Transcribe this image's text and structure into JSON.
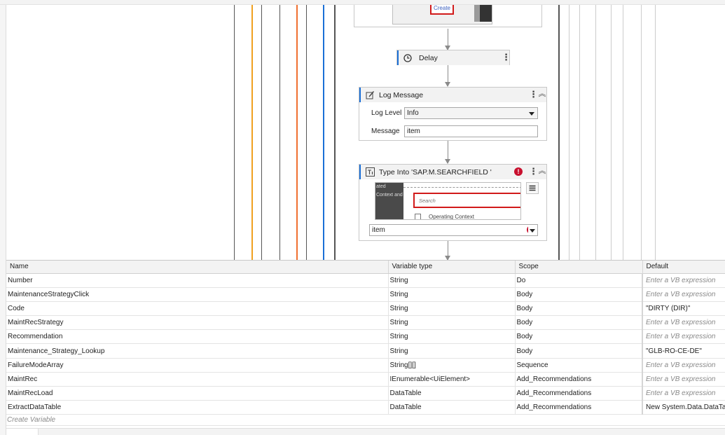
{
  "workflow": {
    "screenshot_top": {
      "button_label": "Create"
    },
    "delay": {
      "title": "Delay"
    },
    "log_message": {
      "title": "Log Message",
      "log_level_label": "Log Level",
      "log_level_value": "Info",
      "message_label": "Message",
      "message_value": "item"
    },
    "type_into": {
      "title": "Type Into 'SAP.M.SEARCHFIELD '",
      "screenshot": {
        "text1": "ated",
        "text2": "Context and",
        "search_placeholder": "Search",
        "checkbox_label": "Operating Context"
      },
      "text_value": "item"
    }
  },
  "variables": {
    "headers": {
      "name": "Name",
      "type": "Variable type",
      "scope": "Scope",
      "default": "Default"
    },
    "rows": [
      {
        "name": "Number",
        "type": "String",
        "scope": "Do",
        "default": "Enter a VB expression",
        "placeholder": true
      },
      {
        "name": "MaintenanceStrategyClick",
        "type": "String",
        "scope": "Body",
        "default": "Enter a VB expression",
        "placeholder": true
      },
      {
        "name": "Code",
        "type": "String",
        "scope": "Body",
        "default": "\"DIRTY (DIR)\"",
        "placeholder": false
      },
      {
        "name": "MaintRecStrategy",
        "type": "String",
        "scope": "Body",
        "default": "Enter a VB expression",
        "placeholder": true
      },
      {
        "name": "Recommendation",
        "type": "String",
        "scope": "Body",
        "default": "Enter a VB expression",
        "placeholder": true
      },
      {
        "name": "Maintenance_Strategy_Lookup",
        "type": "String",
        "scope": "Body",
        "default": "\"GLB-RO-CE-DE\"",
        "placeholder": false
      },
      {
        "name": "FailureModeArray",
        "type": "String[][]",
        "scope": "Sequence",
        "default": "Enter a VB expression",
        "placeholder": true
      },
      {
        "name": "MaintRec",
        "type": "IEnumerable<UiElement>",
        "scope": "Add_Recommendations",
        "default": "Enter a VB expression",
        "placeholder": true
      },
      {
        "name": "MaintRecLoad",
        "type": "DataTable",
        "scope": "Add_Recommendations",
        "default": "Enter a VB expression",
        "placeholder": true
      },
      {
        "name": "ExtractDataTable",
        "type": "DataTable",
        "scope": "Add_Recommendations",
        "default": "New System.Data.DataTable",
        "placeholder": false
      }
    ],
    "create_label": "Create Variable"
  },
  "colors": {
    "accent": "#1a6fd6",
    "error": "#c8102e",
    "highlight_red": "#d11a1a"
  }
}
